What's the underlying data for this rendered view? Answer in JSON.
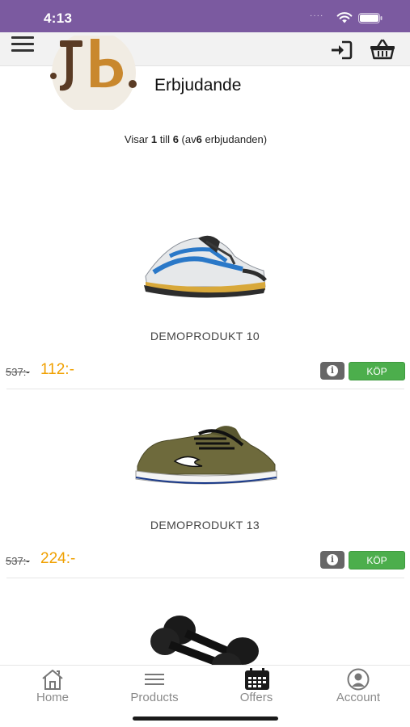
{
  "status_bar": {
    "time": "4:13",
    "dots": "····"
  },
  "header": {
    "menu_icon": "hamburger-menu-icon",
    "login_icon": "sign-in-icon",
    "basket_icon": "shopping-basket-icon"
  },
  "logo": {
    "text": "Jb.",
    "colors": {
      "dark": "#5a3b24",
      "accent": "#c9882e",
      "circle": "#f1ece3"
    }
  },
  "page": {
    "title": "Erbjudande",
    "showing": {
      "prefix": "Visar",
      "from": "1",
      "till_word": "till",
      "to": "6",
      "of_open": "(av",
      "total": "6",
      "of_close": "erbjudanden)"
    }
  },
  "products": [
    {
      "name": "DEMOPRODUKT 10",
      "old_price": "537:-",
      "new_price": "112:-",
      "buy_label": "KÖP",
      "image": "running-shoe-blue"
    },
    {
      "name": "DEMOPRODUKT 13",
      "old_price": "537:-",
      "new_price": "224:-",
      "buy_label": "KÖP",
      "image": "sneaker-olive"
    },
    {
      "image": "dumbbells-black"
    }
  ],
  "tabs": [
    {
      "label": "Home",
      "icon": "home-icon"
    },
    {
      "label": "Products",
      "icon": "list-icon"
    },
    {
      "label": "Offers",
      "icon": "calendar-icon",
      "active": true
    },
    {
      "label": "Account",
      "icon": "account-icon"
    }
  ],
  "colors": {
    "status_bar": "#7b5aa0",
    "price_accent": "#f0a000",
    "buy_button": "#4cae4c",
    "info_button": "#666666"
  }
}
